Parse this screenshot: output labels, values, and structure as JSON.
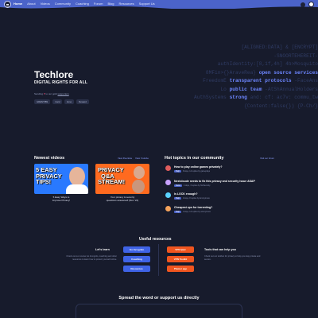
{
  "nav": {
    "items": [
      "Home",
      "About",
      "Videos",
      "Community",
      "Coaching",
      "Forum",
      "Blog",
      "Resources",
      "Support Us"
    ]
  },
  "hero": {
    "title": "Techlore",
    "subtitle": "DIGITAL RIGHTS FOR ALL",
    "line_prefix": "Sending",
    "line_middle": "to our gold",
    "line_link": "supporters",
    "chips": [
      "GRENTIBS",
      "Card",
      "Emo",
      "Reward"
    ]
  },
  "code_lines": [
    {
      "pre": "",
      "hl": "",
      "post": "[ALIGNED:DATA] & [ENCRYPT]"
    },
    {
      "pre": "",
      "hl": "",
      "post": "-SNOORTEHEREIT-"
    },
    {
      "pre": "",
      "hl": "",
      "post": "authIdentity:[8,1f,4h] 4b>Mosquito"
    },
    {
      "pre": "8MFin>{}AraveRea} ",
      "hl": "open source services",
      "post": ""
    },
    {
      "pre": "FreedomE ",
      "hl": "transparent protocols",
      "post": " -FaceAns"
    },
    {
      "pre": "Lo ",
      "hl": "public team",
      "post": " -AtShAnnualHolders"
    },
    {
      "pre": "AuthSystems ",
      "hl": "strong",
      "post": " and: cf: ac7v: commu_tw"
    },
    {
      "pre": "",
      "hl": "",
      "post": "{Content:false(}) {P-Ch/}"
    }
  ],
  "videos": {
    "title": "Newest videos",
    "links": [
      "View Peertube",
      "View Youtube"
    ],
    "items": [
      {
        "thumb_text": [
          "5 EASY",
          "PRIVACY",
          "TIPS!"
        ],
        "caption": [
          "5 Easy Ways to",
          "Improve Privacy!"
        ],
        "bg": "#2979ff"
      },
      {
        "thumb_text": [
          "PRIVACY",
          "Q&A",
          "STREAM!"
        ],
        "caption": [
          "Your privacy & security",
          "questions answered! (Nov '24)"
        ],
        "bg": "#ff6a1f"
      }
    ]
  },
  "topics": {
    "title": "Hot topics in our community",
    "link": "Visit our forum",
    "items": [
      {
        "title": "How to play online games privately?",
        "tag": "Help",
        "meta": "6 days, 14 replies by gameplays",
        "color": "#e05d5d"
      },
      {
        "title": "Nextcloude needs to fix this privacy and security issue ASAP",
        "tag": "News",
        "meta": "4 days, 3 replies by NxtSecurity",
        "color": "#c8a2ff"
      },
      {
        "title": "Is LOCK enough?",
        "tag": "Help",
        "meta": "2 days, 8 replies by Anonymous",
        "color": "#5ad2ff"
      },
      {
        "title": "Cheapest vpn for torrenting?",
        "tag": "Help",
        "meta": "1 days, 14 replies by anonymous",
        "color": "#f5a35c"
      }
    ]
  },
  "useful": {
    "title": "Useful resources",
    "learn_title": "Let's learn",
    "learn_text": "Check out our course Go Incognito, coaching and other resources to learn how to protect yourself online.",
    "tools_title": "Tools that can help you",
    "tools_text": "Check out our toolbox for privacy to help you stay private and secure.",
    "learn_buttons": [
      "Go Incognito",
      "Coaching",
      "Resources"
    ],
    "tool_buttons": [
      "VPN Quiz",
      "VPN Toolkit",
      "Plumer app"
    ]
  },
  "spread": {
    "title": "Spread the word or support us directly"
  },
  "colors": {
    "background": "#171b2c",
    "nav": "#4b63c9",
    "accent": "#6d86ff",
    "orange": "#f0551f"
  }
}
